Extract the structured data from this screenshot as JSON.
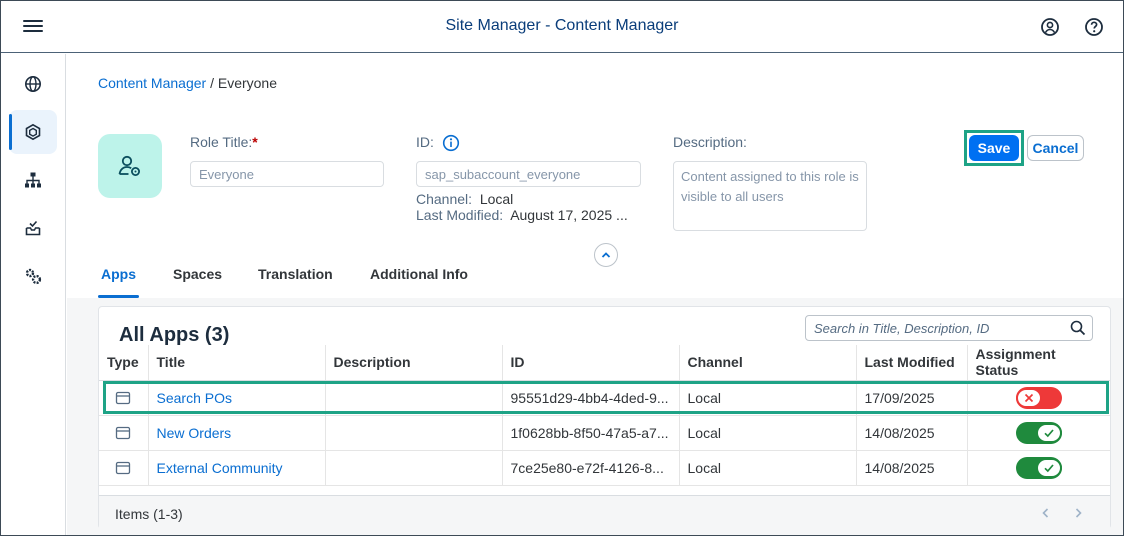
{
  "shell": {
    "title": "Site Manager - Content Manager",
    "icons": [
      "menu-icon",
      "user-icon",
      "help-icon"
    ]
  },
  "sidenav": {
    "items": [
      "globe-icon",
      "content-icon",
      "hierarchy-icon",
      "inbox-icon",
      "settings-icon"
    ],
    "active": "content-icon"
  },
  "breadcrumb": {
    "link": "Content Manager",
    "separator": " / ",
    "current": "Everyone"
  },
  "role": {
    "title_label": "Role Title:",
    "required_mark": "*",
    "title_value": "Everyone",
    "id_label": "ID:",
    "id_value": "sap_subaccount_everyone",
    "channel_label": "Channel:",
    "channel_value": "Local",
    "modified_label": "Last Modified:",
    "modified_value": "August 17, 2025 ...",
    "description_label": "Description:",
    "description_value": "Content assigned to this role is visible to all users"
  },
  "actions": {
    "save": "Save",
    "cancel": "Cancel"
  },
  "tabs": [
    {
      "label": "Apps",
      "active": true
    },
    {
      "label": "Spaces"
    },
    {
      "label": "Translation"
    },
    {
      "label": "Additional Info"
    }
  ],
  "apps": {
    "title": "All Apps (3)",
    "search_placeholder": "Search in Title, Description, ID",
    "columns": [
      "Type",
      "Title",
      "Description",
      "ID",
      "Channel",
      "Last Modified",
      "Assignment Status"
    ],
    "rows": [
      {
        "title": "Search POs",
        "description": "",
        "id": "95551d29-4bb4-4ded-9...",
        "channel": "Local",
        "modified": "17/09/2025",
        "assigned": false
      },
      {
        "title": "New Orders",
        "description": "",
        "id": "1f0628bb-8f50-47a5-a7...",
        "channel": "Local",
        "modified": "14/08/2025",
        "assigned": true
      },
      {
        "title": "External Community",
        "description": "",
        "id": "7ce25e80-e72f-4126-8...",
        "channel": "Local",
        "modified": "14/08/2025",
        "assigned": true
      }
    ],
    "items_text": "Items (1-3)"
  },
  "colors": {
    "accent": "#0a6ed1",
    "save": "#0070f2",
    "highlight": "#1ea386",
    "off": "#ee3939",
    "on": "#1f8a3d"
  }
}
